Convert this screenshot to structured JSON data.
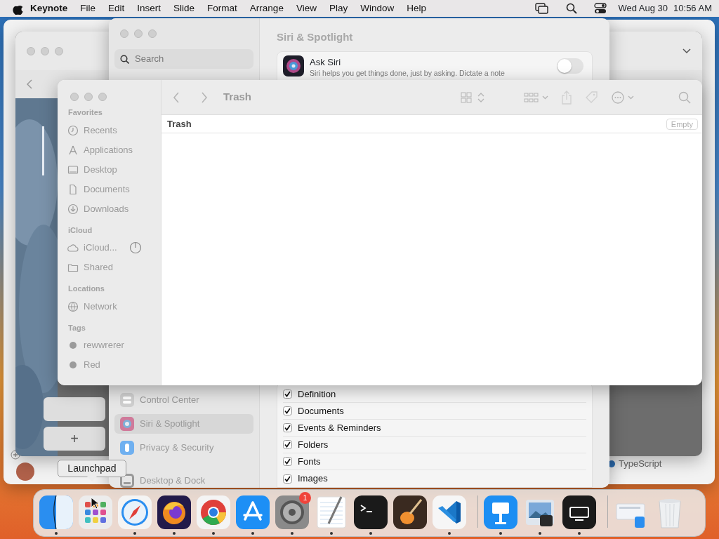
{
  "menu_bar": {
    "app": "Keynote",
    "menus": [
      "File",
      "Edit",
      "Insert",
      "Slide",
      "Format",
      "Arrange",
      "View",
      "Play",
      "Window",
      "Help"
    ],
    "date": "Wed Aug 30",
    "time": "10:56 AM"
  },
  "background_window": {
    "add_button": "+",
    "label": "TypeScript"
  },
  "settings_window": {
    "title": "Siri & Spotlight",
    "search": {
      "placeholder": "Search"
    },
    "sidebar": [
      {
        "kind": "control",
        "label": "Control Center",
        "selected": false
      },
      {
        "kind": "siri",
        "label": "Siri & Spotlight",
        "selected": true
      },
      {
        "kind": "privacy",
        "label": "Privacy & Security",
        "selected": false
      },
      {
        "kind": "dock",
        "label": "Desktop & Dock",
        "selected": false
      }
    ],
    "ask_siri": {
      "label": "Ask Siri",
      "description": "Siri helps you get things done, just by asking. Dictate a note",
      "on": false
    },
    "results": [
      {
        "label": "Definition",
        "checked": true
      },
      {
        "label": "Documents",
        "checked": true
      },
      {
        "label": "Events & Reminders",
        "checked": true
      },
      {
        "label": "Folders",
        "checked": true
      },
      {
        "label": "Fonts",
        "checked": true
      },
      {
        "label": "Images",
        "checked": true
      }
    ]
  },
  "finder_window": {
    "title": "Trash",
    "path": "Trash",
    "empty_button": "Empty",
    "sidebar": [
      {
        "heading": "Favorites",
        "items": [
          {
            "kind": "clock",
            "label": "Recents"
          },
          {
            "kind": "apps",
            "label": "Applications"
          },
          {
            "kind": "desktop",
            "label": "Desktop"
          },
          {
            "kind": "document",
            "label": "Documents"
          },
          {
            "kind": "download",
            "label": "Downloads"
          }
        ]
      },
      {
        "heading": "iCloud",
        "items": [
          {
            "kind": "cloud",
            "label": "iCloud...",
            "syncing": true
          },
          {
            "kind": "shared",
            "label": "Shared"
          }
        ]
      },
      {
        "heading": "Locations",
        "items": [
          {
            "kind": "network",
            "label": "Network"
          }
        ]
      },
      {
        "heading": "Tags",
        "items": [
          {
            "kind": "tag",
            "label": "rewwrerer"
          },
          {
            "kind": "tag",
            "label": "Red"
          }
        ]
      }
    ]
  },
  "tooltip": "Launchpad",
  "dock": {
    "apps": [
      {
        "kind": "finder",
        "running": true
      },
      {
        "kind": "launchpad",
        "running": false
      },
      {
        "kind": "safari",
        "running": true
      },
      {
        "kind": "firefox",
        "running": true
      },
      {
        "kind": "chrome",
        "running": true
      },
      {
        "kind": "appstore",
        "running": true
      },
      {
        "kind": "settings",
        "running": true,
        "badge": "1"
      },
      {
        "kind": "textedit",
        "running": true
      },
      {
        "kind": "terminal",
        "running": true
      },
      {
        "kind": "garageband",
        "running": false
      },
      {
        "kind": "vscode",
        "running": true
      }
    ],
    "recent": [
      {
        "kind": "keynote",
        "running": true
      },
      {
        "kind": "preview",
        "running": true
      },
      {
        "kind": "tv",
        "running": true
      }
    ],
    "stacks": [
      {
        "kind": "stack"
      },
      {
        "kind": "trash"
      }
    ]
  }
}
